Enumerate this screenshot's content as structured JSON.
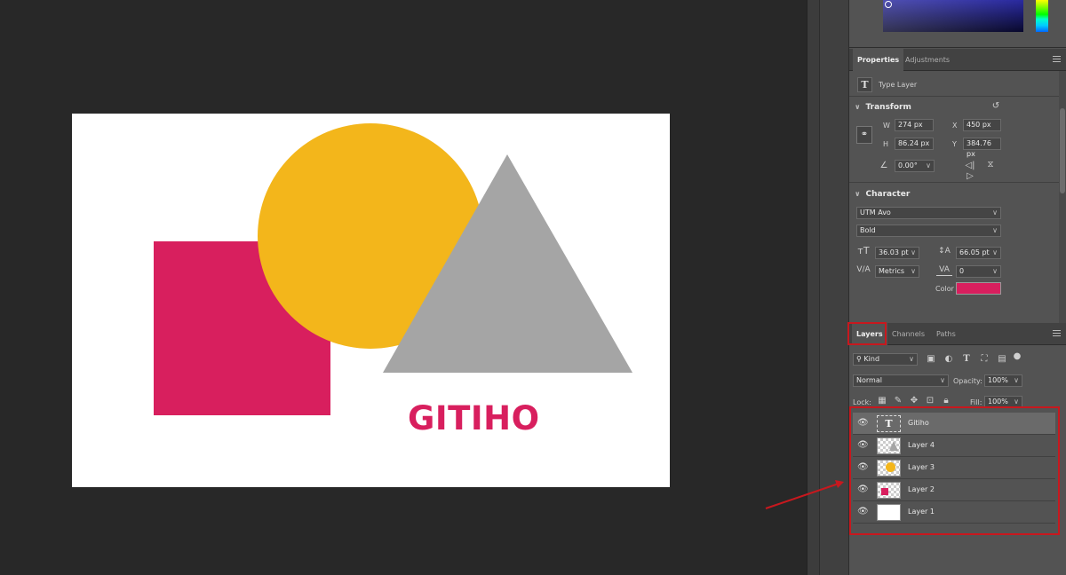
{
  "canvas": {
    "logo_text": "GITIHO",
    "shape_colors": {
      "square": "#d81f5e",
      "circle": "#f3b61b",
      "triangle": "#a5a5a5"
    }
  },
  "properties_panel": {
    "tabs": [
      "Properties",
      "Adjustments"
    ],
    "layer_kind": "Type Layer",
    "transform": {
      "heading": "Transform",
      "w_label": "W",
      "w_value": "274 px",
      "h_label": "H",
      "h_value": "86.24 px",
      "x_label": "X",
      "x_value": "450 px",
      "y_label": "Y",
      "y_value": "384.76 px",
      "angle_value": "0.00°"
    },
    "character": {
      "heading": "Character",
      "font_family": "UTM Avo",
      "font_style": "Bold",
      "font_size": "36.03 pt",
      "leading": "66.05 pt",
      "kerning": "Metrics",
      "tracking": "0",
      "color_label": "Color",
      "color_value": "#d81f5e"
    }
  },
  "layers_panel": {
    "tabs": [
      "Layers",
      "Channels",
      "Paths"
    ],
    "filter_kind": "Kind",
    "blend_mode": "Normal",
    "opacity_label": "Opacity:",
    "opacity_value": "100%",
    "lock_label": "Lock:",
    "fill_label": "Fill:",
    "fill_value": "100%",
    "layers": [
      {
        "name": "Gitiho",
        "type": "text",
        "visible": true,
        "selected": true
      },
      {
        "name": "Layer 4",
        "type": "triangle",
        "visible": true,
        "selected": false
      },
      {
        "name": "Layer 3",
        "type": "circle",
        "visible": true,
        "selected": false
      },
      {
        "name": "Layer 2",
        "type": "square",
        "visible": true,
        "selected": false
      },
      {
        "name": "Layer 1",
        "type": "background",
        "visible": true,
        "selected": false
      }
    ]
  },
  "annotation": {
    "highlight_color": "#c8181e"
  }
}
